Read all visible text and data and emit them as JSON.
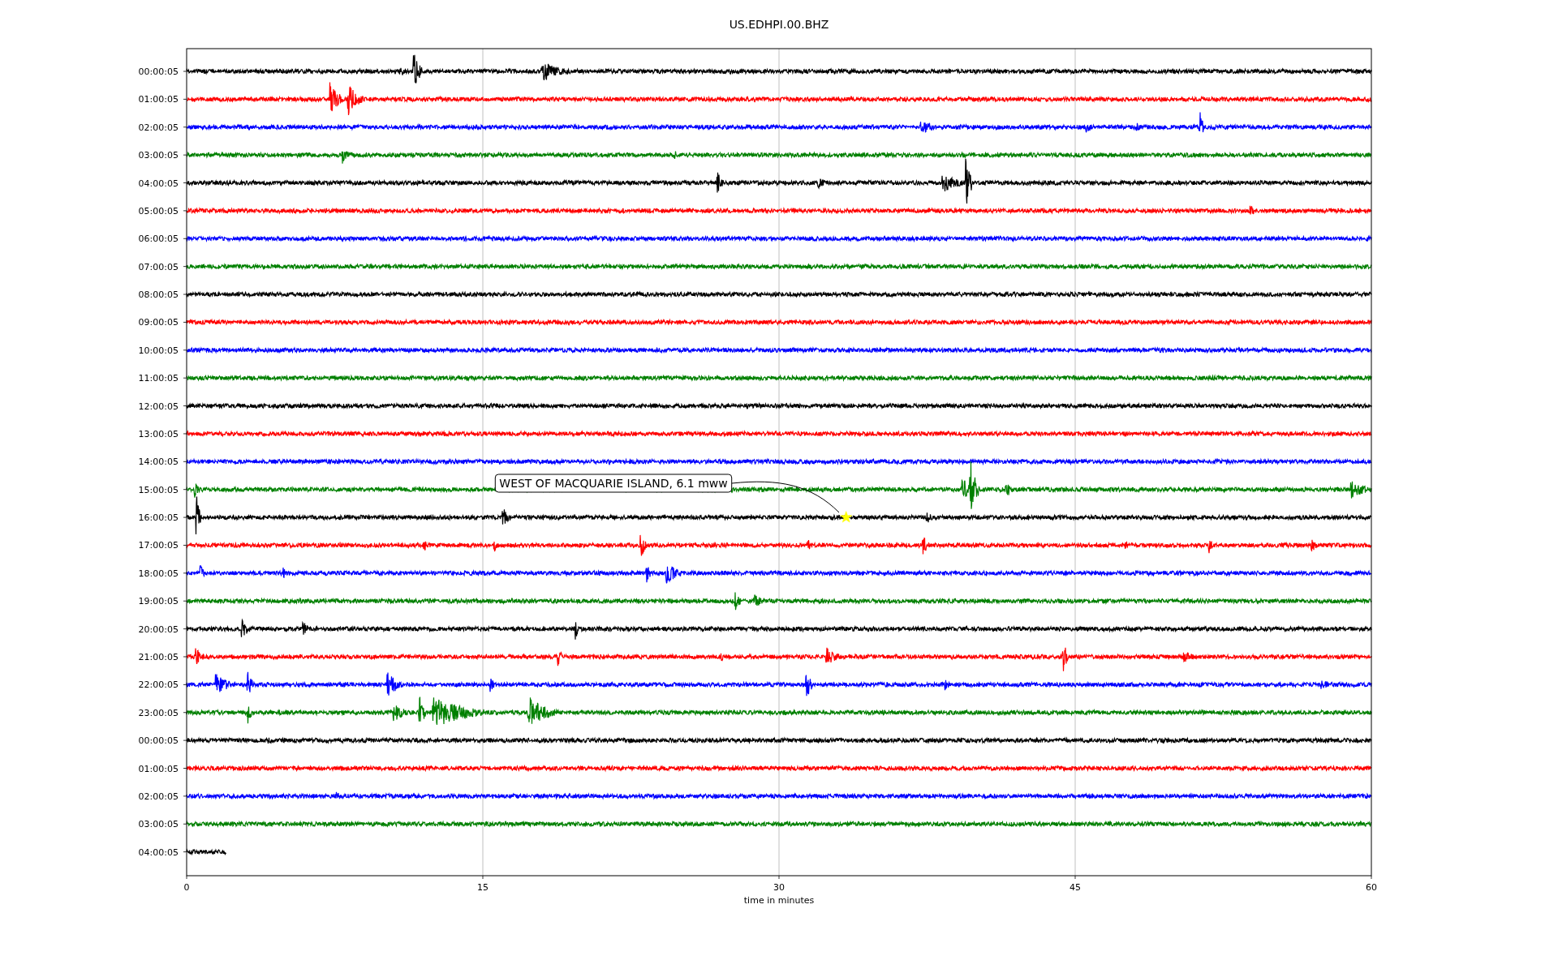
{
  "title": "US.EDHPI.00.BHZ",
  "rows": [
    {
      "label": "00:00:05",
      "color": "#000000"
    },
    {
      "label": "01:00:05",
      "color": "#ff0000"
    },
    {
      "label": "02:00:05",
      "color": "#0000ff"
    },
    {
      "label": "03:00:05",
      "color": "#008000"
    },
    {
      "label": "04:00:05",
      "color": "#000000"
    },
    {
      "label": "05:00:05",
      "color": "#ff0000"
    },
    {
      "label": "06:00:05",
      "color": "#0000ff"
    },
    {
      "label": "07:00:05",
      "color": "#008000"
    },
    {
      "label": "08:00:05",
      "color": "#000000"
    },
    {
      "label": "09:00:05",
      "color": "#ff0000"
    },
    {
      "label": "10:00:05",
      "color": "#0000ff"
    },
    {
      "label": "11:00:05",
      "color": "#008000"
    },
    {
      "label": "12:00:05",
      "color": "#000000"
    },
    {
      "label": "13:00:05",
      "color": "#ff0000"
    },
    {
      "label": "14:00:05",
      "color": "#0000ff"
    },
    {
      "label": "15:00:05",
      "color": "#008000"
    },
    {
      "label": "16:00:05",
      "color": "#000000"
    },
    {
      "label": "17:00:05",
      "color": "#ff0000"
    },
    {
      "label": "18:00:05",
      "color": "#0000ff"
    },
    {
      "label": "19:00:05",
      "color": "#008000"
    },
    {
      "label": "20:00:05",
      "color": "#000000"
    },
    {
      "label": "21:00:05",
      "color": "#ff0000"
    },
    {
      "label": "22:00:05",
      "color": "#0000ff"
    },
    {
      "label": "23:00:05",
      "color": "#008000"
    },
    {
      "label": "00:00:05",
      "color": "#000000"
    },
    {
      "label": "01:00:05",
      "color": "#ff0000"
    },
    {
      "label": "02:00:05",
      "color": "#0000ff"
    },
    {
      "label": "03:00:05",
      "color": "#008000"
    },
    {
      "label": "04:00:05",
      "color": "#000000"
    }
  ],
  "xticks": [
    "0",
    "15",
    "30",
    "45",
    "60"
  ],
  "xlabel": "time in minutes",
  "annotation": {
    "text": "WEST OF MACQUARIE ISLAND, 6.1 mww"
  }
}
